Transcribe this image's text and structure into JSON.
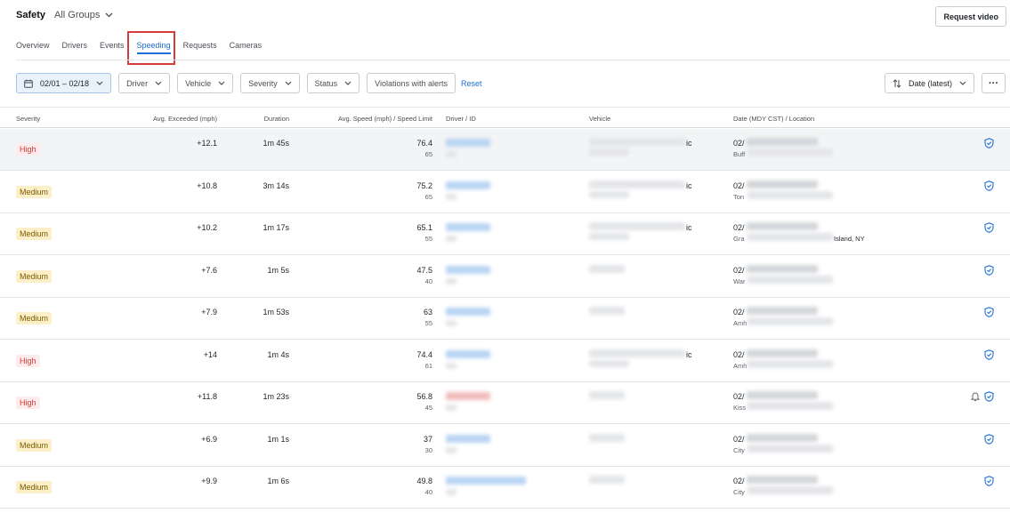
{
  "header": {
    "title": "Safety",
    "group": "All Groups",
    "request_video": "Request video"
  },
  "tabs": [
    {
      "label": "Overview"
    },
    {
      "label": "Drivers"
    },
    {
      "label": "Events"
    },
    {
      "label": "Speeding",
      "active": true
    },
    {
      "label": "Requests"
    },
    {
      "label": "Cameras"
    }
  ],
  "filters": {
    "date_range": "02/01 – 02/18",
    "driver": "Driver",
    "vehicle": "Vehicle",
    "severity": "Severity",
    "status": "Status",
    "violations": "Violations with alerts",
    "reset": "Reset",
    "sort": "Date (latest)",
    "more": "···"
  },
  "columns": {
    "severity": "Severity",
    "avg_exceeded": "Avg. Exceeded (mph)",
    "duration": "Duration",
    "avg_speed": "Avg. Speed (mph) / Speed Limit",
    "driver": "Driver / ID",
    "vehicle": "Vehicle",
    "date": "Date (MDY CST) / Location"
  },
  "rows": [
    {
      "severity": "High",
      "exceeded": "+12.1",
      "duration": "1m 45s",
      "speed": "76.4",
      "limit": "65",
      "vehicle_suffix": "ic",
      "date_prefix": "02/",
      "loc_prefix": "Buff",
      "loc_suffix": "",
      "bell": false
    },
    {
      "severity": "Medium",
      "exceeded": "+10.8",
      "duration": "3m 14s",
      "speed": "75.2",
      "limit": "65",
      "vehicle_suffix": "ic",
      "date_prefix": "02/",
      "loc_prefix": "Ton",
      "loc_suffix": "",
      "bell": false
    },
    {
      "severity": "Medium",
      "exceeded": "+10.2",
      "duration": "1m 17s",
      "speed": "65.1",
      "limit": "55",
      "vehicle_suffix": "ic",
      "date_prefix": "02/",
      "loc_prefix": "Gra",
      "loc_suffix": "Island, NY",
      "bell": false
    },
    {
      "severity": "Medium",
      "exceeded": "+7.6",
      "duration": "1m 5s",
      "speed": "47.5",
      "limit": "40",
      "vehicle_suffix": "",
      "date_prefix": "02/",
      "loc_prefix": "War",
      "loc_suffix": "",
      "bell": false
    },
    {
      "severity": "Medium",
      "exceeded": "+7.9",
      "duration": "1m 53s",
      "speed": "63",
      "limit": "55",
      "vehicle_suffix": "",
      "date_prefix": "02/",
      "loc_prefix": "Amh",
      "loc_suffix": "",
      "bell": false
    },
    {
      "severity": "High",
      "exceeded": "+14",
      "duration": "1m 4s",
      "speed": "74.4",
      "limit": "61",
      "vehicle_suffix": "ic",
      "date_prefix": "02/",
      "loc_prefix": "Amh",
      "loc_suffix": "",
      "bell": false
    },
    {
      "severity": "High",
      "exceeded": "+11.8",
      "duration": "1m 23s",
      "speed": "56.8",
      "limit": "45",
      "vehicle_suffix": "",
      "date_prefix": "02/",
      "loc_prefix": "Kiss",
      "loc_suffix": "",
      "bell": true
    },
    {
      "severity": "Medium",
      "exceeded": "+6.9",
      "duration": "1m 1s",
      "speed": "37",
      "limit": "30",
      "vehicle_suffix": "",
      "date_prefix": "02/",
      "loc_prefix": "City",
      "loc_suffix": "",
      "bell": false
    },
    {
      "severity": "Medium",
      "exceeded": "+9.9",
      "duration": "1m 6s",
      "speed": "49.8",
      "limit": "40",
      "vehicle_suffix": "",
      "date_prefix": "02/",
      "loc_prefix": "City",
      "loc_suffix": "",
      "bell": false
    }
  ],
  "colors": {
    "accent": "#1b6fd6",
    "high": "#d23a3a",
    "medium_bg": "#fdf0c8",
    "highlight_box": "#d63b3b"
  }
}
